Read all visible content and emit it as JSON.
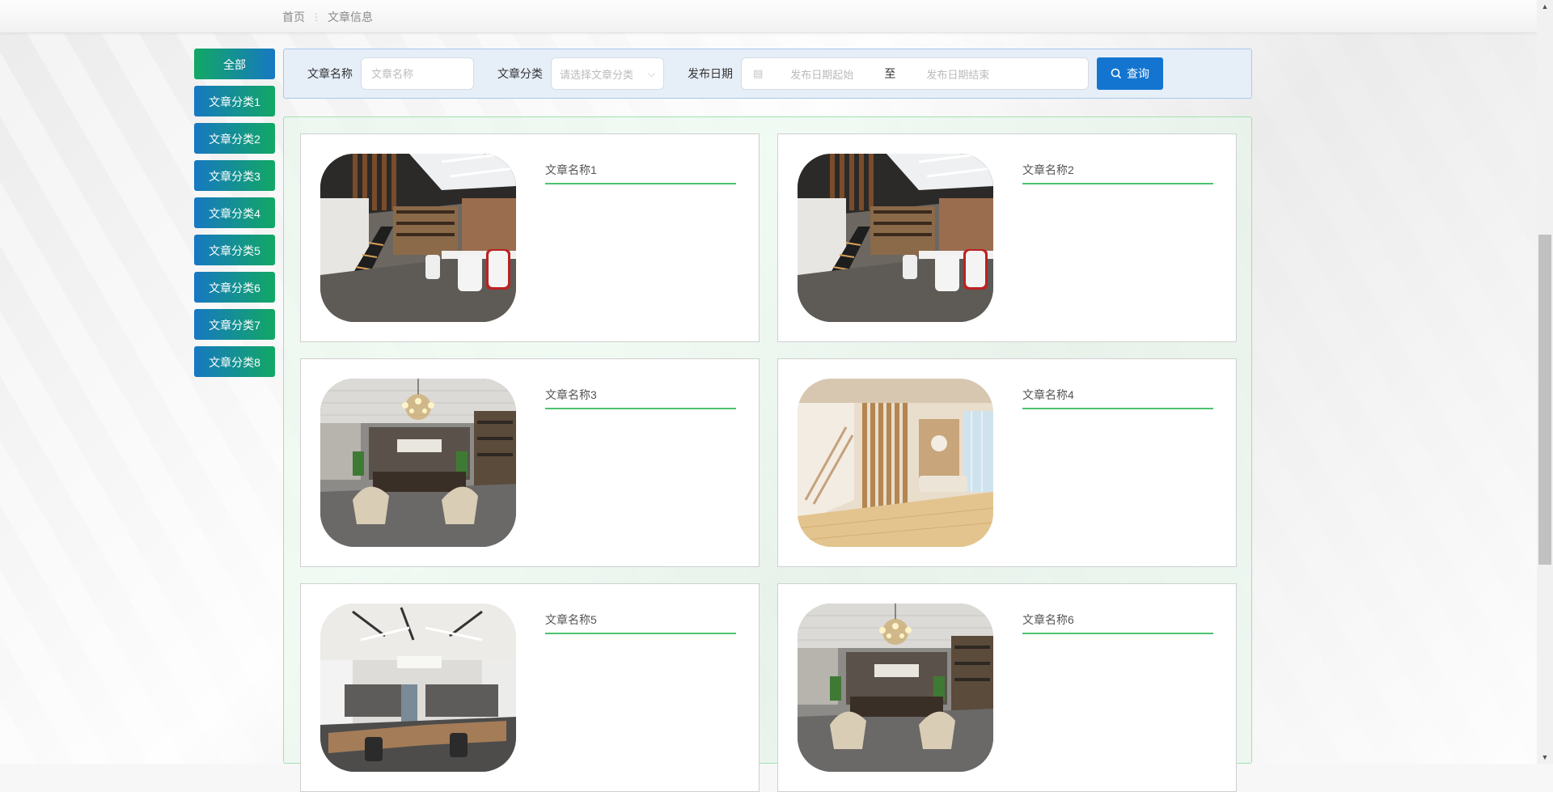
{
  "breadcrumb": {
    "home": "首页",
    "separator": "⋮",
    "current": "文章信息"
  },
  "categories": [
    {
      "label": "全部",
      "active": true
    },
    {
      "label": "文章分类1"
    },
    {
      "label": "文章分类2"
    },
    {
      "label": "文章分类3"
    },
    {
      "label": "文章分类4"
    },
    {
      "label": "文章分类5"
    },
    {
      "label": "文章分类6"
    },
    {
      "label": "文章分类7"
    },
    {
      "label": "文章分类8"
    }
  ],
  "search": {
    "name_label": "文章名称",
    "name_placeholder": "文章名称",
    "category_label": "文章分类",
    "category_placeholder": "请选择文章分类",
    "date_label": "发布日期",
    "date_start_placeholder": "发布日期起始",
    "date_to": "至",
    "date_end_placeholder": "发布日期结束",
    "button_label": "查询"
  },
  "articles": [
    {
      "title": "文章名称1",
      "image": "office-loft-staircase"
    },
    {
      "title": "文章名称2",
      "image": "office-loft-staircase"
    },
    {
      "title": "文章名称3",
      "image": "executive-office-chandelier"
    },
    {
      "title": "文章名称4",
      "image": "wood-lobby-staircase"
    },
    {
      "title": "文章名称5",
      "image": "open-office-desks"
    },
    {
      "title": "文章名称6",
      "image": "executive-office-chandelier"
    }
  ],
  "colors": {
    "accent_blue": "#1375d0",
    "accent_green": "#4cc36f",
    "nav_gradient_start": "#1778c2",
    "nav_gradient_end": "#12a864"
  }
}
